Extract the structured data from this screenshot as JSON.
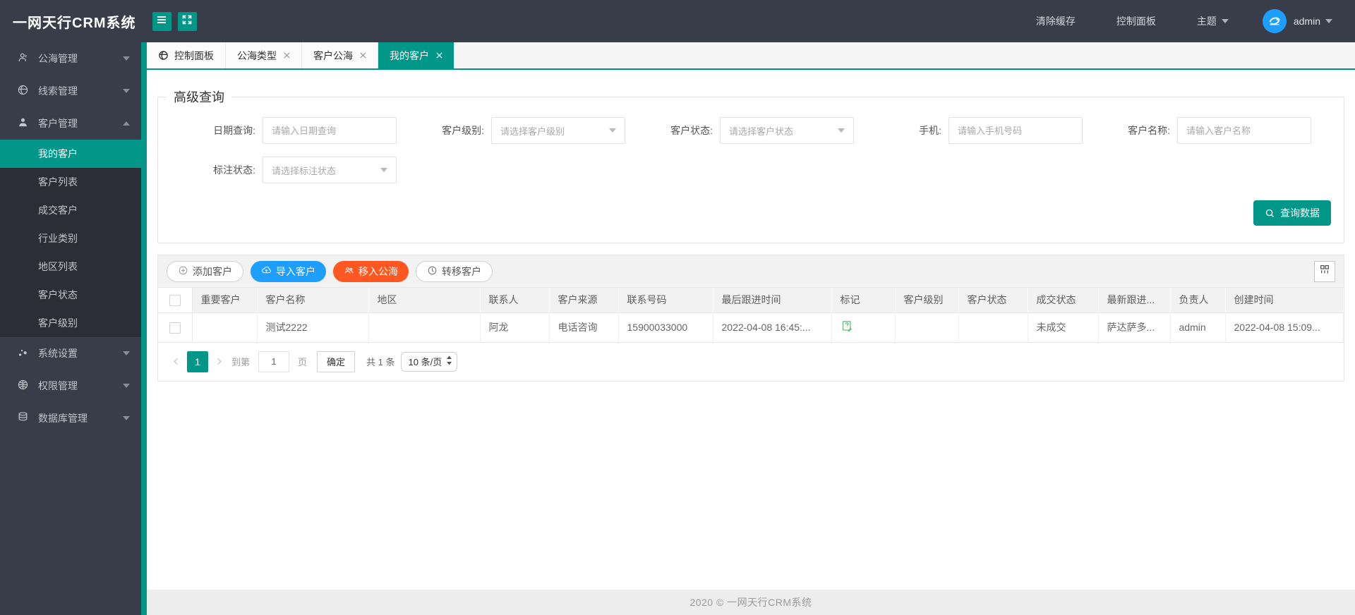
{
  "colors": {
    "accent": "#009688",
    "blue": "#1E9FFF",
    "orange": "#FF5722",
    "dark": "#393D49"
  },
  "app": {
    "title": "一网天行CRM系统"
  },
  "header": {
    "clear_cache": "清除缓存",
    "control_panel": "控制面板",
    "theme": "主题",
    "user": "admin"
  },
  "tabs": [
    {
      "label": "控制面板",
      "active": false,
      "closable": false
    },
    {
      "label": "公海类型",
      "active": false,
      "closable": true
    },
    {
      "label": "客户公海",
      "active": false,
      "closable": true
    },
    {
      "label": "我的客户",
      "active": true,
      "closable": true
    }
  ],
  "sidebar": {
    "items": [
      {
        "label": "公海管理",
        "icon": "users-icon",
        "expanded": false
      },
      {
        "label": "线索管理",
        "icon": "globe-icon",
        "expanded": false
      },
      {
        "label": "客户管理",
        "icon": "user-icon",
        "expanded": true,
        "children": [
          {
            "label": "我的客户",
            "active": true
          },
          {
            "label": "客户列表",
            "active": false
          },
          {
            "label": "成交客户",
            "active": false
          },
          {
            "label": "行业类别",
            "active": false
          },
          {
            "label": "地区列表",
            "active": false
          },
          {
            "label": "客户状态",
            "active": false
          },
          {
            "label": "客户级别",
            "active": false
          }
        ]
      },
      {
        "label": "系统设置",
        "icon": "nodes-icon",
        "expanded": false
      },
      {
        "label": "权限管理",
        "icon": "globe-grid-icon",
        "expanded": false
      },
      {
        "label": "数据库管理",
        "icon": "database-icon",
        "expanded": false
      }
    ]
  },
  "query": {
    "legend": "高级查询",
    "fields": [
      {
        "label": "日期查询:",
        "type": "input",
        "placeholder": "请输入日期查询"
      },
      {
        "label": "客户级别:",
        "type": "select",
        "placeholder": "请选择客户级别"
      },
      {
        "label": "客户状态:",
        "type": "select",
        "placeholder": "请选择客户状态"
      },
      {
        "label": "手机:",
        "type": "input",
        "placeholder": "请输入手机号码"
      },
      {
        "label": "客户名称:",
        "type": "input",
        "placeholder": "请输入客户名称"
      },
      {
        "label": "标注状态:",
        "type": "select",
        "placeholder": "请选择标注状态"
      }
    ],
    "submit_label": "查询数据"
  },
  "toolbar": {
    "buttons": [
      {
        "label": "添加客户",
        "style": "default",
        "icon": "plus-circle-icon"
      },
      {
        "label": "导入客户",
        "style": "blue",
        "icon": "cloud-upload-icon"
      },
      {
        "label": "移入公海",
        "style": "orange",
        "icon": "users-icon"
      },
      {
        "label": "转移客户",
        "style": "default",
        "icon": "clock-icon"
      }
    ]
  },
  "table": {
    "columns": [
      "重要客户",
      "客户名称",
      "地区",
      "联系人",
      "客户来源",
      "联系号码",
      "最后跟进时间",
      "标记",
      "客户级别",
      "客户状态",
      "成交状态",
      "最新跟进...",
      "负责人",
      "创建时间"
    ],
    "rows": [
      {
        "important": "",
        "name": "测试2222",
        "region": "",
        "contact": "阿龙",
        "source": "电话咨询",
        "phone": "15900033000",
        "last_follow_time": "2022-04-08 16:45:...",
        "mark": "question-edit-icon",
        "level": "",
        "status": "",
        "deal_status": "未成交",
        "latest_follow": "萨达萨多...",
        "owner": "admin",
        "create_time": "2022-04-08 15:09..."
      }
    ]
  },
  "pagination": {
    "current": "1",
    "goto_prefix": "到第",
    "page_value": "1",
    "goto_suffix": "页",
    "confirm": "确定",
    "total": "共 1 条",
    "page_size": "10 条/页"
  },
  "footer": {
    "text": "2020 ©   一网天行CRM系统"
  }
}
